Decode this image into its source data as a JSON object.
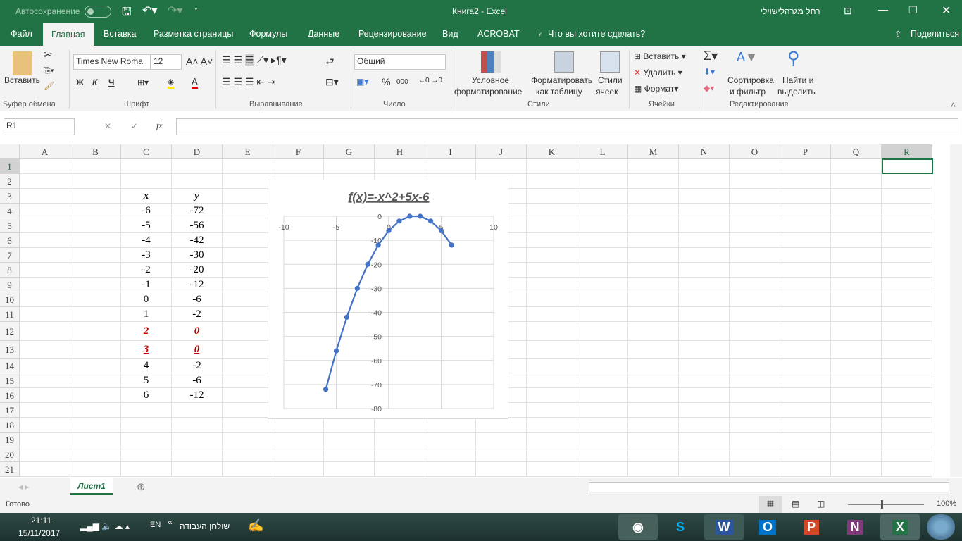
{
  "titlebar": {
    "autosave": "Автосохранение",
    "title": "Книга2  -  Excel",
    "user": "רחל מגרהלישוילי"
  },
  "tabs": [
    "Файл",
    "Главная",
    "Вставка",
    "Разметка страницы",
    "Формулы",
    "Данные",
    "Рецензирование",
    "Вид",
    "ACROBAT"
  ],
  "tell_me": "Что вы хотите сделать?",
  "share": "Поделиться",
  "ribbon": {
    "paste": "Вставить",
    "clipboard": "Буфер обмена",
    "font_name": "Times New Roma",
    "font_size": "12",
    "bold": "Ж",
    "italic": "К",
    "underline": "Ч",
    "font_group": "Шрифт",
    "alignment_group": "Выравнивание",
    "number_format": "Общий",
    "number_group": "Число",
    "cond_format1": "Условное",
    "cond_format2": "форматирование",
    "format_table1": "Форматировать",
    "format_table2": "как таблицу",
    "cell_styles1": "Стили",
    "cell_styles2": "ячеек",
    "styles_group": "Стили",
    "insert": "Вставить",
    "delete": "Удалить",
    "format": "Формат",
    "cells_group": "Ячейки",
    "sort1": "Сортировка",
    "sort2": "и фильтр",
    "find1": "Найти и",
    "find2": "выделить",
    "editing_group": "Редактирование",
    "percent": "%",
    "thousands": "000"
  },
  "formula_bar": {
    "name_box": "R1",
    "fx": "fx",
    "value": ""
  },
  "columns": [
    "A",
    "B",
    "C",
    "D",
    "E",
    "F",
    "G",
    "H",
    "I",
    "J",
    "K",
    "L",
    "M",
    "N",
    "O",
    "P",
    "Q",
    "R"
  ],
  "rows": [
    "1",
    "2",
    "3",
    "4",
    "5",
    "6",
    "7",
    "8",
    "9",
    "10",
    "11",
    "12",
    "13",
    "14",
    "15",
    "16",
    "17",
    "18",
    "19",
    "20",
    "21"
  ],
  "table": {
    "x_header": "x",
    "y_header": "y",
    "x": [
      "-6",
      "-5",
      "-4",
      "-3",
      "-2",
      "-1",
      "0",
      "1",
      "2",
      "3",
      "4",
      "5",
      "6"
    ],
    "y": [
      "-72",
      "-56",
      "-42",
      "-30",
      "-20",
      "-12",
      "-6",
      "-2",
      "0",
      "0",
      "-2",
      "-6",
      "-12"
    ]
  },
  "chart_data": {
    "type": "scatter",
    "title": "f(x)=-x^2+5x-6",
    "x": [
      -6,
      -5,
      -4,
      -3,
      -2,
      -1,
      0,
      1,
      2,
      3,
      4,
      5,
      6
    ],
    "y": [
      -72,
      -56,
      -42,
      -30,
      -20,
      -12,
      -6,
      -2,
      0,
      0,
      -2,
      -6,
      -12
    ],
    "xlim": [
      -10,
      10
    ],
    "ylim": [
      -80,
      0
    ],
    "xticks": [
      "-10",
      "-5",
      "0",
      "5",
      "10"
    ],
    "yticks": [
      "0",
      "-10",
      "-20",
      "-30",
      "-40",
      "-50",
      "-60",
      "-70",
      "-80"
    ],
    "grid": true,
    "series_color": "#4472c4"
  },
  "sheet_tab": "Лист1",
  "status": {
    "ready": "Готово",
    "zoom": "100%"
  },
  "taskbar": {
    "time": "21:11",
    "date": "15/11/2017",
    "lang": "EN",
    "desktop": "שולחן העבודה"
  }
}
